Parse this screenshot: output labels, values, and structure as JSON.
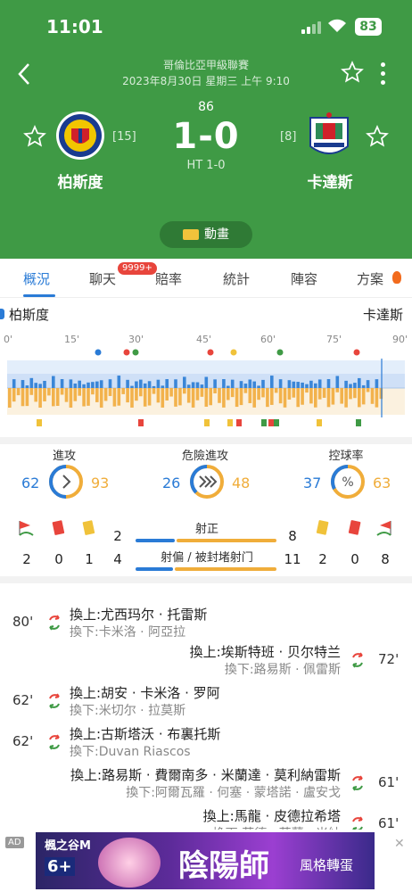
{
  "status": {
    "time": "11:01",
    "battery": "83"
  },
  "match": {
    "league": "哥倫比亞甲級聯賽",
    "datetime": "2023年8月30日 星期三 上午 9:10",
    "minute": "86",
    "score": "1-0",
    "ht": "HT 1-0",
    "home": {
      "name": "柏斯度",
      "rank": "[15]"
    },
    "away": {
      "name": "卡達斯",
      "rank": "[8]"
    },
    "anim_label": "動畫"
  },
  "tabs": [
    {
      "label": "概況"
    },
    {
      "label": "聊天"
    },
    {
      "label": "賠率"
    },
    {
      "label": "統計"
    },
    {
      "label": "陣容"
    },
    {
      "label": "方案"
    }
  ],
  "chat_badge": "9999+",
  "timeline": {
    "home": "柏斯度",
    "away": "卡達斯",
    "ticks": [
      "0'",
      "15'",
      "30'",
      "45'",
      "60'",
      "75'",
      "90'"
    ]
  },
  "stats": {
    "attack": {
      "label": "進攻",
      "home": "62",
      "away": "93"
    },
    "danger": {
      "label": "危險進攻",
      "home": "26",
      "away": "48"
    },
    "possession": {
      "label": "控球率",
      "home": "37",
      "away": "63",
      "icon": "%"
    },
    "shots_on": {
      "label": "射正",
      "home": "2",
      "away": "8"
    },
    "shots_off": {
      "label": "射偏 / 被封堵射门",
      "home": "4",
      "away": "11"
    },
    "home_cards": {
      "corners": "2",
      "red": "0",
      "yellow": "1"
    },
    "away_cards": {
      "yellow": "2",
      "red": "0",
      "corners": "8"
    }
  },
  "subs": [
    {
      "min": "80'",
      "side": "home",
      "on": "換上:尤西玛尔 · 托雷斯",
      "off": "換下:卡米洛 · 阿亞拉"
    },
    {
      "min": "72'",
      "side": "away",
      "on": "換上:埃斯特班 · 贝尔特兰",
      "off": "換下:路易斯 · 佩雷斯"
    },
    {
      "min": "62'",
      "side": "home",
      "on": "換上:胡安 · 卡米洛 · 罗阿",
      "off": "換下:米切尔 · 拉莫斯"
    },
    {
      "min": "62'",
      "side": "home",
      "on": "換上:古斯塔沃 · 布裏托斯",
      "off": "換下:Duvan Riascos"
    },
    {
      "min": "61'",
      "side": "away",
      "on": "換上:路易斯 · 費爾南多 · 米蘭達 · 莫利納雷斯",
      "off": "換下:阿爾瓦羅 · 何塞 · 蒙塔諾 · 盧安戈"
    },
    {
      "min": "61'",
      "side": "away",
      "on": "換上:馬龍 · 皮德拉希塔",
      "off": "換下:莫德 · 莫蘭 · 米納"
    }
  ],
  "ad": {
    "label": "AD",
    "game": "楓之谷M",
    "title": "陰陽師",
    "sub": "風格轉蛋",
    "age": "6+"
  },
  "colors": {
    "header": "#3f9a45",
    "home": "#2a7bd6",
    "away": "#f0ad3a"
  }
}
